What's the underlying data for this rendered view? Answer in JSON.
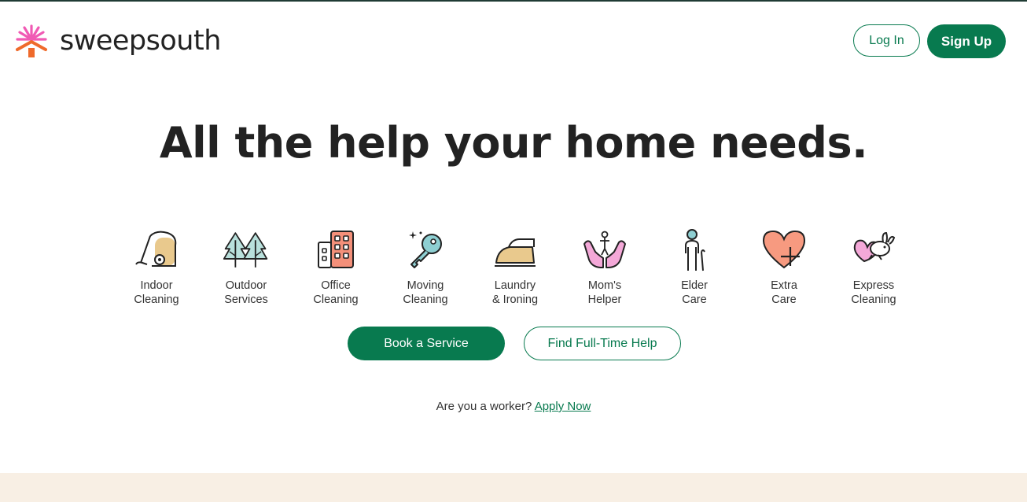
{
  "header": {
    "logo_text": "sweepsouth",
    "login_label": "Log In",
    "signup_label": "Sign Up"
  },
  "hero": {
    "title": "All the help your home needs."
  },
  "services": [
    {
      "label": "Indoor\nCleaning",
      "icon": "vacuum-icon"
    },
    {
      "label": "Outdoor\nServices",
      "icon": "trees-icon"
    },
    {
      "label": "Office\nCleaning",
      "icon": "building-icon"
    },
    {
      "label": "Moving\nCleaning",
      "icon": "key-icon"
    },
    {
      "label": "Laundry\n& Ironing",
      "icon": "iron-icon"
    },
    {
      "label": "Mom's\nHelper",
      "icon": "hands-child-icon"
    },
    {
      "label": "Elder\nCare",
      "icon": "elder-icon"
    },
    {
      "label": "Extra\nCare",
      "icon": "heart-plus-icon"
    },
    {
      "label": "Express\nCleaning",
      "icon": "rabbit-heart-icon"
    }
  ],
  "actions": {
    "book_label": "Book a Service",
    "fulltime_label": "Find Full-Time Help"
  },
  "worker": {
    "prompt": "Are you a worker?",
    "link": "Apply Now"
  },
  "colors": {
    "brand_green": "#087a4f",
    "footer_band": "#f8efe4",
    "logo_pink": "#f05ab4",
    "logo_orange": "#ef6a2b"
  }
}
